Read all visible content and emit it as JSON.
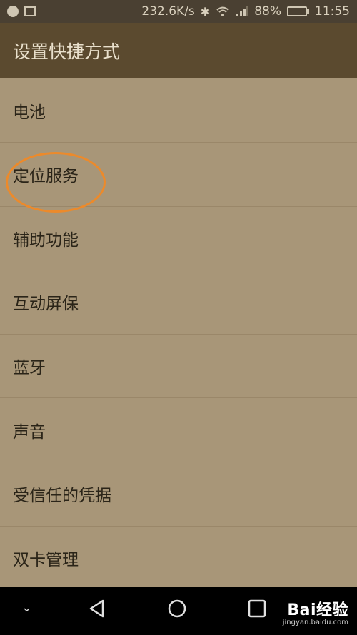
{
  "status_bar": {
    "speed": "232.6K/s",
    "battery": "88%",
    "battery_level": 0.88,
    "time": "11:55",
    "icons": [
      "notification-icon",
      "image-icon",
      "bluetooth-icon",
      "wifi-icon",
      "signal-icon",
      "battery-icon"
    ]
  },
  "app_bar": {
    "title": "设置快捷方式"
  },
  "list": {
    "items": [
      {
        "label": "电池"
      },
      {
        "label": "定位服务"
      },
      {
        "label": "辅助功能"
      },
      {
        "label": "互动屏保"
      },
      {
        "label": "蓝牙"
      },
      {
        "label": "声音"
      },
      {
        "label": "受信任的凭据"
      },
      {
        "label": "双卡管理"
      }
    ]
  },
  "annotation": {
    "color": "#ec8a2b",
    "highlighted_item": "定位服务"
  },
  "nav_bar": {
    "buttons": [
      "chevron-down-icon",
      "back-icon",
      "home-icon",
      "recents-icon"
    ]
  },
  "watermark": {
    "main": "Bai经验",
    "sub": "jingyan.baidu.com"
  }
}
